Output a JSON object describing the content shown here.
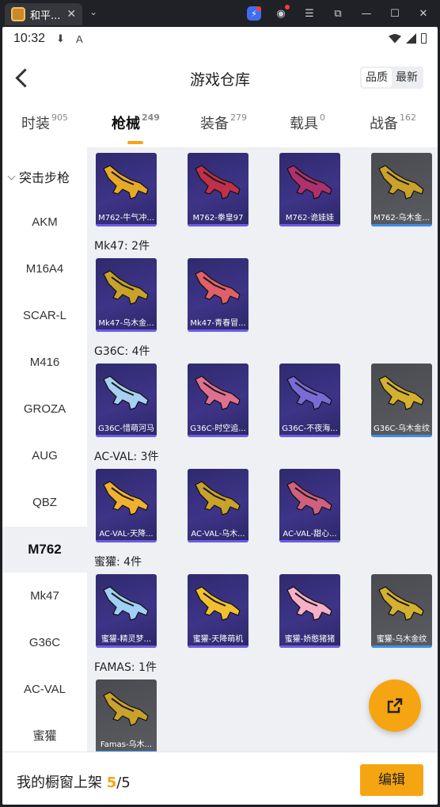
{
  "window": {
    "tab_title": "和平...",
    "tab_close": "✕",
    "dropdown": "⌄"
  },
  "status_bar": {
    "time": "10:32",
    "icons": [
      "⬇",
      "A"
    ]
  },
  "header": {
    "title": "游戏仓库",
    "sort_options": [
      "品质",
      "最新"
    ],
    "active_sort": "品质"
  },
  "categories": [
    {
      "label": "时装",
      "count": "905"
    },
    {
      "label": "枪械",
      "count": "249"
    },
    {
      "label": "装备",
      "count": "279"
    },
    {
      "label": "载具",
      "count": "0"
    },
    {
      "label": "战备",
      "count": "162"
    }
  ],
  "active_category": "枪械",
  "sidebar": {
    "group": "突击步枪",
    "items": [
      "AKM",
      "M16A4",
      "SCAR-L",
      "M416",
      "GROZA",
      "AUG",
      "QBZ",
      "M762",
      "Mk47",
      "G36C",
      "AC-VAL",
      "蜜獾"
    ],
    "active": "M762"
  },
  "sections": [
    {
      "title": "",
      "items": [
        {
          "name": "M762-牛气冲...",
          "tier": "purple",
          "gun_color": "#e6a92a"
        },
        {
          "name": "M762-拳皇97",
          "tier": "purple",
          "gun_color": "#c0304a"
        },
        {
          "name": "M762-诡娃娃",
          "tier": "purple",
          "gun_color": "#b0306e"
        },
        {
          "name": "M762-乌木金...",
          "tier": "grey",
          "gun_color": "#c9a22c"
        }
      ]
    },
    {
      "title": "Mk47: 2件",
      "items": [
        {
          "name": "Mk47-乌木金...",
          "tier": "purple",
          "gun_color": "#c9a22c"
        },
        {
          "name": "Mk47-青春冒...",
          "tier": "purple",
          "gun_color": "#e0606a"
        }
      ]
    },
    {
      "title": "G36C: 4件",
      "items": [
        {
          "name": "G36C-惜萌河马",
          "tier": "purple",
          "gun_color": "#a8d0f0"
        },
        {
          "name": "G36C-时空追...",
          "tier": "purple",
          "gun_color": "#e07090"
        },
        {
          "name": "G36C-不夜海...",
          "tier": "purple",
          "gun_color": "#7a6ad8"
        },
        {
          "name": "G36C-乌木金纹",
          "tier": "grey",
          "gun_color": "#d4b030"
        }
      ]
    },
    {
      "title": "AC-VAL: 3件",
      "items": [
        {
          "name": "AC-VAL-天降...",
          "tier": "purple",
          "gun_color": "#f0b030"
        },
        {
          "name": "AC-VAL-乌木...",
          "tier": "purple",
          "gun_color": "#c9a22c"
        },
        {
          "name": "AC-VAL-甜心...",
          "tier": "purple",
          "gun_color": "#d06080"
        }
      ]
    },
    {
      "title": "蜜獾: 4件",
      "items": [
        {
          "name": "蜜獾-精灵梦...",
          "tier": "purple",
          "gun_color": "#9fd0f5"
        },
        {
          "name": "蜜獾-天降萌机",
          "tier": "purple",
          "gun_color": "#f0c030"
        },
        {
          "name": "蜜獾-娇憨猪猪",
          "tier": "purple",
          "gun_color": "#f5b0c8"
        },
        {
          "name": "蜜獾-乌木金纹",
          "tier": "grey",
          "gun_color": "#d4b030"
        }
      ]
    },
    {
      "title": "FAMAS: 1件",
      "items": [
        {
          "name": "Famas-乌木...",
          "tier": "grey",
          "gun_color": "#c9a22c"
        }
      ]
    }
  ],
  "showcase": {
    "label": "我的橱窗上架",
    "current": "5",
    "separator": "/",
    "total": "5"
  },
  "edit_button": "编辑",
  "colors": {
    "accent": "#f5a512",
    "purple_tier": "#3e3488",
    "grey_tier": "#5b5c61"
  }
}
